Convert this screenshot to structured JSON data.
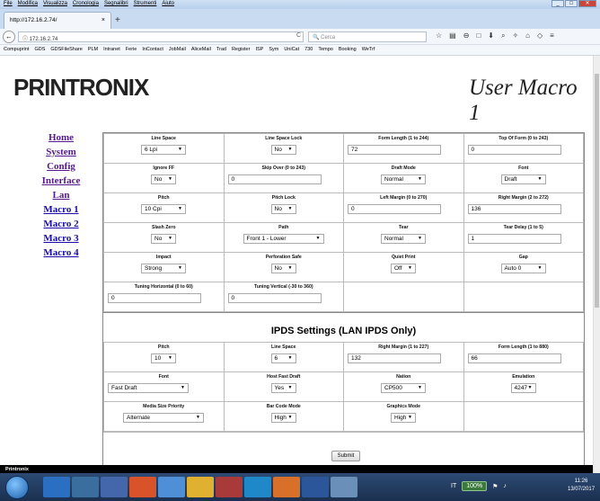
{
  "browser": {
    "menu": [
      "File",
      "Modifica",
      "Visualizza",
      "Cronologia",
      "Segnalibri",
      "Strumenti",
      "Aiuto"
    ],
    "tab_title": "http://172.16.2.74/",
    "tab_close": "×",
    "new_tab": "+",
    "url": "172.16.2.74",
    "search_placeholder": "Cerca",
    "bookmarks": [
      "Compuprint",
      "GDS",
      "GDSFileShare",
      "PLM",
      "Intranet",
      "Ferie",
      "InContact",
      "JobMail",
      "AliceMail",
      "Trad",
      "Register",
      "ISP",
      "Sym",
      "UniCat",
      "730",
      "Tempo",
      "Booking",
      "WeTrf"
    ]
  },
  "header": {
    "logo": "PRINTRONIX",
    "title": "User Macro 1"
  },
  "nav": [
    {
      "label": "Home",
      "visited": true
    },
    {
      "label": "System",
      "visited": true
    },
    {
      "label": "Config",
      "visited": true
    },
    {
      "label": "Interface",
      "visited": true
    },
    {
      "label": "Lan",
      "visited": true
    },
    {
      "label": "Macro 1",
      "visited": false
    },
    {
      "label": "Macro 2",
      "visited": false
    },
    {
      "label": "Macro 3",
      "visited": false
    },
    {
      "label": "Macro 4",
      "visited": false
    }
  ],
  "macro_fields": [
    {
      "label": "Line Space",
      "type": "select",
      "value": "6 Lpi"
    },
    {
      "label": "Line Space Lock",
      "type": "select",
      "value": "No"
    },
    {
      "label": "Form Length (1 to 244)",
      "type": "text",
      "value": "72"
    },
    {
      "label": "Top Of Form (0 to 243)",
      "type": "text",
      "value": "0"
    },
    {
      "label": "Ignore FF",
      "type": "select",
      "value": "No"
    },
    {
      "label": "Skip Over (0 to 243)",
      "type": "text",
      "value": "0"
    },
    {
      "label": "Draft Mode",
      "type": "select",
      "value": "Normal"
    },
    {
      "label": "Font",
      "type": "select",
      "value": "Draft"
    },
    {
      "label": "Pitch",
      "type": "select",
      "value": "10 Cpi"
    },
    {
      "label": "Pitch Lock",
      "type": "select",
      "value": "No"
    },
    {
      "label": "Left Margin (0 to 270)",
      "type": "text",
      "value": "0"
    },
    {
      "label": "Right Margin (2 to 272)",
      "type": "text",
      "value": "136"
    },
    {
      "label": "Slash Zero",
      "type": "select",
      "value": "No"
    },
    {
      "label": "Path",
      "type": "select",
      "value": "Front 1 - Lower"
    },
    {
      "label": "Tear",
      "type": "select",
      "value": "Normal"
    },
    {
      "label": "Tear Delay (1 to 5)",
      "type": "text",
      "value": "1"
    },
    {
      "label": "Impact",
      "type": "select",
      "value": "Strong"
    },
    {
      "label": "Perforation Safe",
      "type": "select",
      "value": "No"
    },
    {
      "label": "Quiet Print",
      "type": "select",
      "value": "Off"
    },
    {
      "label": "Gap",
      "type": "select",
      "value": "Auto 0"
    },
    {
      "label": "Tuning Horizontal (0 to 60)",
      "type": "text",
      "value": "0"
    },
    {
      "label": "Tuning Vertical (-30 to 360)",
      "type": "text",
      "value": "0"
    }
  ],
  "ipds": {
    "heading": "IPDS Settings (LAN IPDS Only)",
    "fields": [
      {
        "label": "Pitch",
        "type": "select",
        "value": "10"
      },
      {
        "label": "Line Space",
        "type": "select",
        "value": "6"
      },
      {
        "label": "Right Margin (1 to 227)",
        "type": "text",
        "value": "132"
      },
      {
        "label": "Form Length (1 to 880)",
        "type": "text",
        "value": "66"
      },
      {
        "label": "Font",
        "type": "select",
        "value": "Fast Draft"
      },
      {
        "label": "Host Fast Draft",
        "type": "select",
        "value": "Yes"
      },
      {
        "label": "Nation",
        "type": "select",
        "value": "CP500"
      },
      {
        "label": "Emulation",
        "type": "select",
        "value": "4247"
      },
      {
        "label": "Media Size Priority",
        "type": "select",
        "value": "Alternate"
      },
      {
        "label": "Bar Code Mode",
        "type": "select",
        "value": "High"
      },
      {
        "label": "Graphics Mode",
        "type": "select",
        "value": "High"
      }
    ]
  },
  "submit_label": "Submit",
  "footer": "Printronix",
  "taskbar": {
    "lang": "IT",
    "zoom": "100%",
    "time": "11:26",
    "date": "13/07/2017"
  },
  "colors": {
    "link": "#1a0dab",
    "visited": "#551a8b",
    "footer_bg": "#000000",
    "taskbar_bg": "#1b3050"
  }
}
